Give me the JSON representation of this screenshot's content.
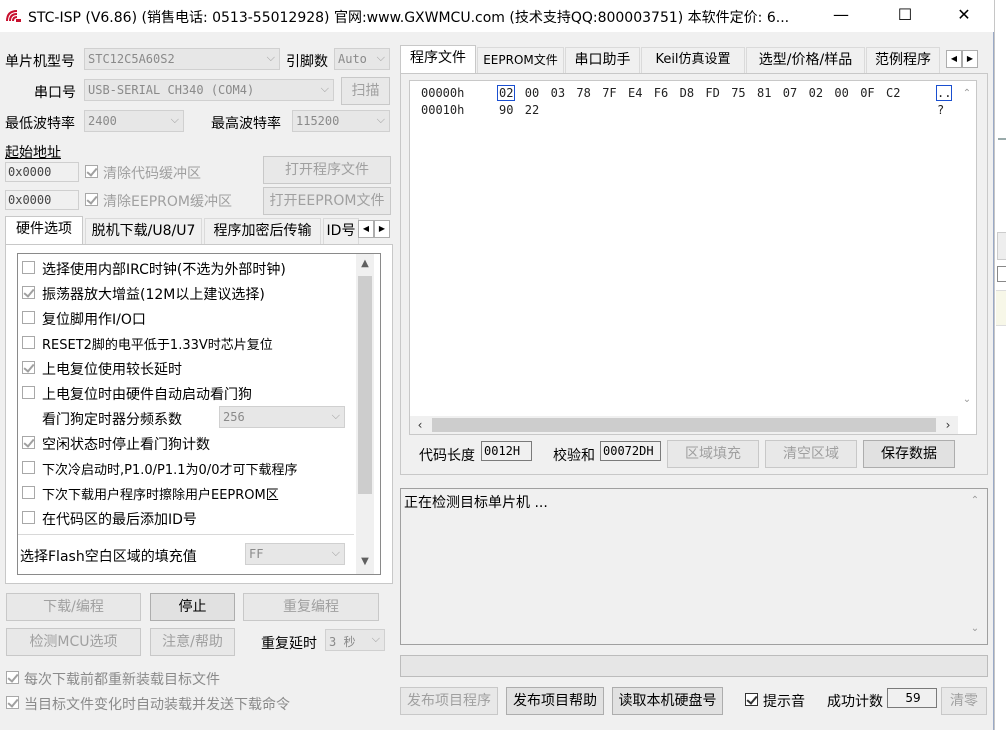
{
  "window": {
    "title": "STC-ISP (V6.86) (销售电话: 0513-55012928) 官网:www.GXWMCU.com  (技术支持QQ:800003751) 本软件定价: 6...",
    "minimize": "—",
    "maximize": "☐",
    "close": "✕"
  },
  "left": {
    "mcu_type_label": "单片机型号",
    "mcu_type_value": "STC12C5A60S2",
    "pins_label": "引脚数",
    "pins_value": "Auto",
    "port_label": "串口号",
    "port_value": "USB-SERIAL CH340 (COM4)",
    "scan_button": "扫描",
    "min_baud_label": "最低波特率",
    "min_baud_value": "2400",
    "max_baud_label": "最高波特率",
    "max_baud_value": "115200",
    "start_addr_label": "起始地址",
    "addr1_value": "0x0000",
    "clear_code_label": "清除代码缓冲区",
    "open_program_button": "打开程序文件",
    "addr2_value": "0x0000",
    "clear_eeprom_label": "清除EEPROM缓冲区",
    "open_eeprom_button": "打开EEPROM文件",
    "tabs": [
      "硬件选项",
      "脱机下载/U8/U7",
      "程序加密后传输",
      "ID号"
    ],
    "options": [
      {
        "label": "选择使用内部IRC时钟(不选为外部时钟)",
        "checked": false
      },
      {
        "label": "振荡器放大增益(12M以上建议选择)",
        "checked": true
      },
      {
        "label": "复位脚用作I/O口",
        "checked": false
      },
      {
        "label": "RESET2脚的电平低于1.33V时芯片复位",
        "checked": false
      },
      {
        "label": "上电复位使用较长延时",
        "checked": true
      },
      {
        "label": "上电复位时由硬件自动启动看门狗",
        "checked": false
      }
    ],
    "watchdog_label": "看门狗定时器分频系数",
    "watchdog_value": "256",
    "options2": [
      {
        "label": "空闲状态时停止看门狗计数",
        "checked": true
      },
      {
        "label": "下次冷启动时,P1.0/P1.1为0/0才可下载程序",
        "checked": false
      },
      {
        "label": "下次下载用户程序时擦除用户EEPROM区",
        "checked": false
      },
      {
        "label": "在代码区的最后添加ID号",
        "checked": false
      }
    ],
    "fill_label": "选择Flash空白区域的填充值",
    "fill_value": "FF",
    "download_button": "下载/编程",
    "stop_button": "停止",
    "reprogram_button": "重复编程",
    "detect_button": "检测MCU选项",
    "help_button": "注意/帮助",
    "repeat_delay_label": "重复延时",
    "repeat_delay_value": "3 秒",
    "reload_label": "每次下载前都重新装载目标文件",
    "auto_reload_label": "当目标文件变化时自动装载并发送下载命令"
  },
  "right": {
    "tabs": [
      "程序文件",
      "EEPROM文件",
      "串口助手",
      "Keil仿真设置",
      "选型/价格/样品",
      "范例程序"
    ],
    "hex_rows": [
      {
        "addr": "00000h",
        "bytes": [
          "02",
          "00",
          "03",
          "78",
          "7F",
          "E4",
          "F6",
          "D8",
          "FD",
          "75",
          "81",
          "07",
          "02",
          "00",
          "0F",
          "C2"
        ],
        "ascii": ".."
      },
      {
        "addr": "00010h",
        "bytes": [
          "90",
          "22"
        ],
        "ascii": "?"
      }
    ],
    "code_len_label": "代码长度",
    "code_len_value": "0012H",
    "checksum_label": "校验和",
    "checksum_value": "00072DH",
    "fill_area_button": "区域填充",
    "clear_area_button": "清空区域",
    "save_data_button": "保存数据",
    "status_text": "正在检测目标单片机 ...",
    "publish_button": "发布项目程序",
    "publish_help_button": "发布项目帮助",
    "read_disk_button": "读取本机硬盘号",
    "sound_label": "提示音",
    "success_count_label": "成功计数",
    "success_count_value": "59",
    "clear_count_button": "清零"
  },
  "colors": {
    "window_bg": "#f0f0f0",
    "selection_box": "#1a4fd0"
  }
}
